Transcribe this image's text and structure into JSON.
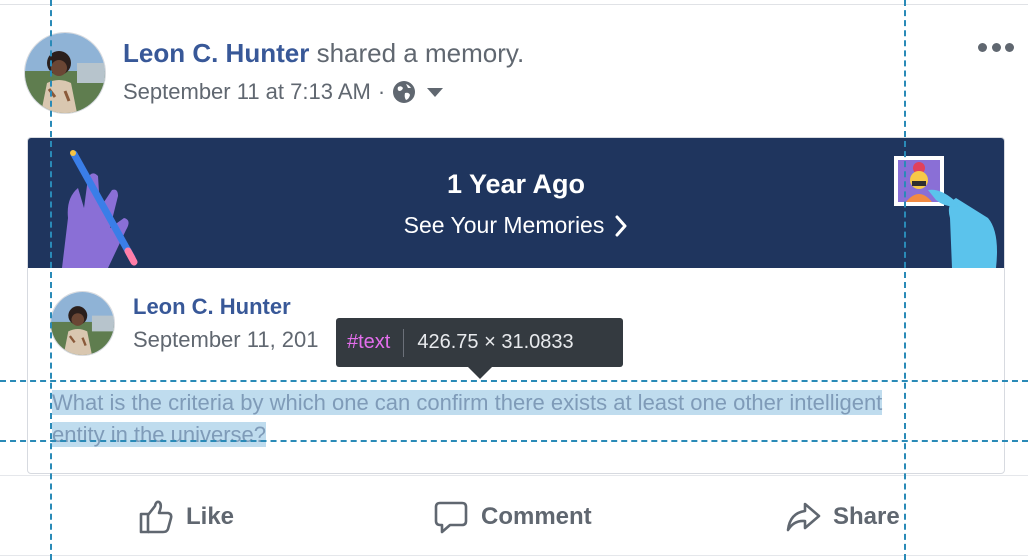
{
  "post": {
    "author": "Leon C. Hunter",
    "action": " shared a memory.",
    "timestamp": "September 11 at 7:13 AM",
    "separator": "·",
    "privacy_icon": "globe-icon",
    "menu_icon": "more-horizontal-icon"
  },
  "memory": {
    "banner_title": "1 Year Ago",
    "banner_link": "See Your Memories",
    "banner_colors": {
      "background": "#1f355e",
      "left_hand": "#8a6fd6",
      "right_hand": "#5bc3ec"
    },
    "inner_author": "Leon C. Hunter",
    "inner_date": "September 11, 201",
    "text": "What is the criteria by which one can confirm there exists at least one other intelligent entity in the universe?"
  },
  "tooltip": {
    "tag": "#text",
    "dimensions": "426.75 × 31.0833"
  },
  "actions": [
    {
      "label": "Like",
      "icon": "thumbs-up-icon"
    },
    {
      "label": "Comment",
      "icon": "comment-bubble-icon"
    },
    {
      "label": "Share",
      "icon": "share-arrow-icon"
    }
  ],
  "colors": {
    "link": "#385898",
    "muted": "#606770",
    "highlight": "#bfdcee",
    "guide": "#2a8ab7",
    "tooltip_bg": "#343a40",
    "tooltip_tag": "#e36eec"
  }
}
